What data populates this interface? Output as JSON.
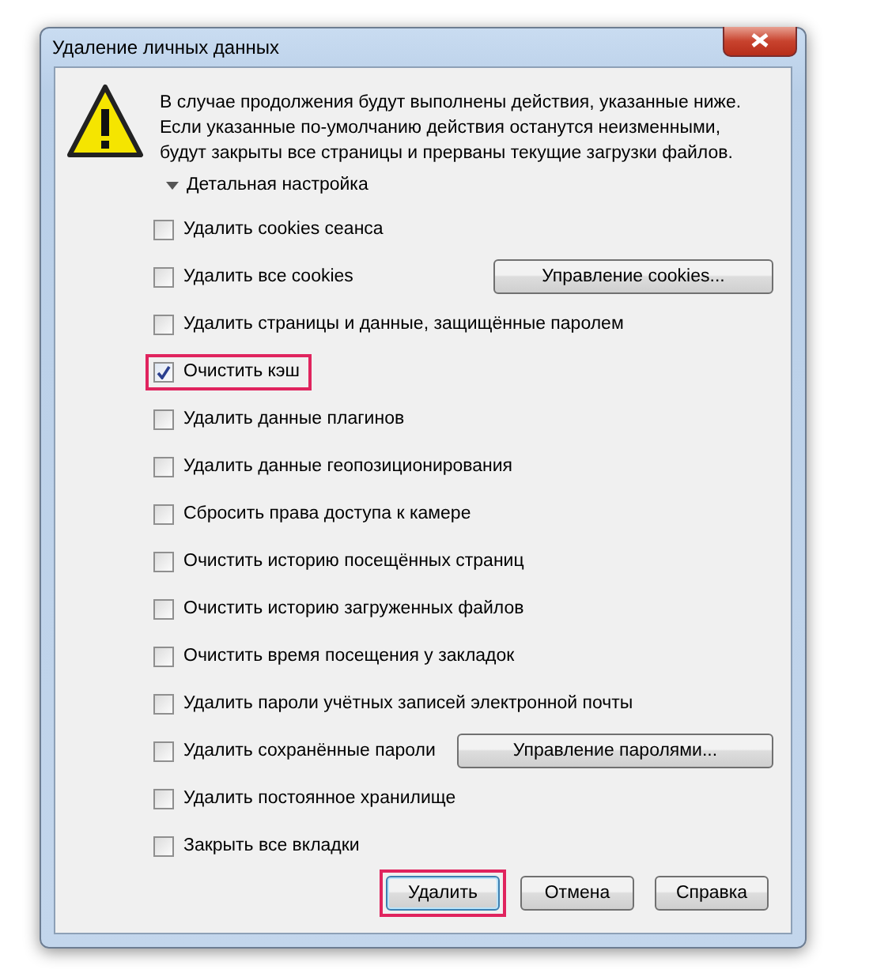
{
  "window": {
    "title": "Удаление личных данных"
  },
  "message": [
    "В случае продолжения будут выполнены действия, указанные ниже.",
    "Если указанные по-умолчанию действия останутся неизменными,",
    "будут закрыты все страницы и прерваны текущие загрузки файлов."
  ],
  "details": {
    "label": "Детальная настройка",
    "expanded": true
  },
  "options": [
    {
      "label": "Удалить cookies сеанса",
      "checked": false,
      "highlighted": false
    },
    {
      "label": "Удалить все cookies",
      "checked": false,
      "highlighted": false,
      "button": "Управление cookies..."
    },
    {
      "label": "Удалить страницы и данные, защищённые паролем",
      "checked": false,
      "highlighted": false
    },
    {
      "label": "Очистить кэш",
      "checked": true,
      "highlighted": true
    },
    {
      "label": "Удалить данные плагинов",
      "checked": false,
      "highlighted": false
    },
    {
      "label": "Удалить данные геопозиционирования",
      "checked": false,
      "highlighted": false
    },
    {
      "label": "Сбросить права доступа к камере",
      "checked": false,
      "highlighted": false
    },
    {
      "label": "Очистить историю посещённых страниц",
      "checked": false,
      "highlighted": false
    },
    {
      "label": "Очистить историю загруженных файлов",
      "checked": false,
      "highlighted": false
    },
    {
      "label": "Очистить время посещения у закладок",
      "checked": false,
      "highlighted": false
    },
    {
      "label": "Удалить пароли учётных записей электронной почты",
      "checked": false,
      "highlighted": false
    },
    {
      "label": "Удалить сохранённые пароли",
      "checked": false,
      "highlighted": false,
      "button": "Управление паролями..."
    },
    {
      "label": "Удалить постоянное хранилище",
      "checked": false,
      "highlighted": false
    },
    {
      "label": "Закрыть все вкладки",
      "checked": false,
      "highlighted": false
    }
  ],
  "buttons": [
    {
      "label": "Удалить",
      "default": true,
      "highlighted": true
    },
    {
      "label": "Отмена",
      "default": false,
      "highlighted": false
    },
    {
      "label": "Справка",
      "default": false,
      "highlighted": false
    }
  ]
}
